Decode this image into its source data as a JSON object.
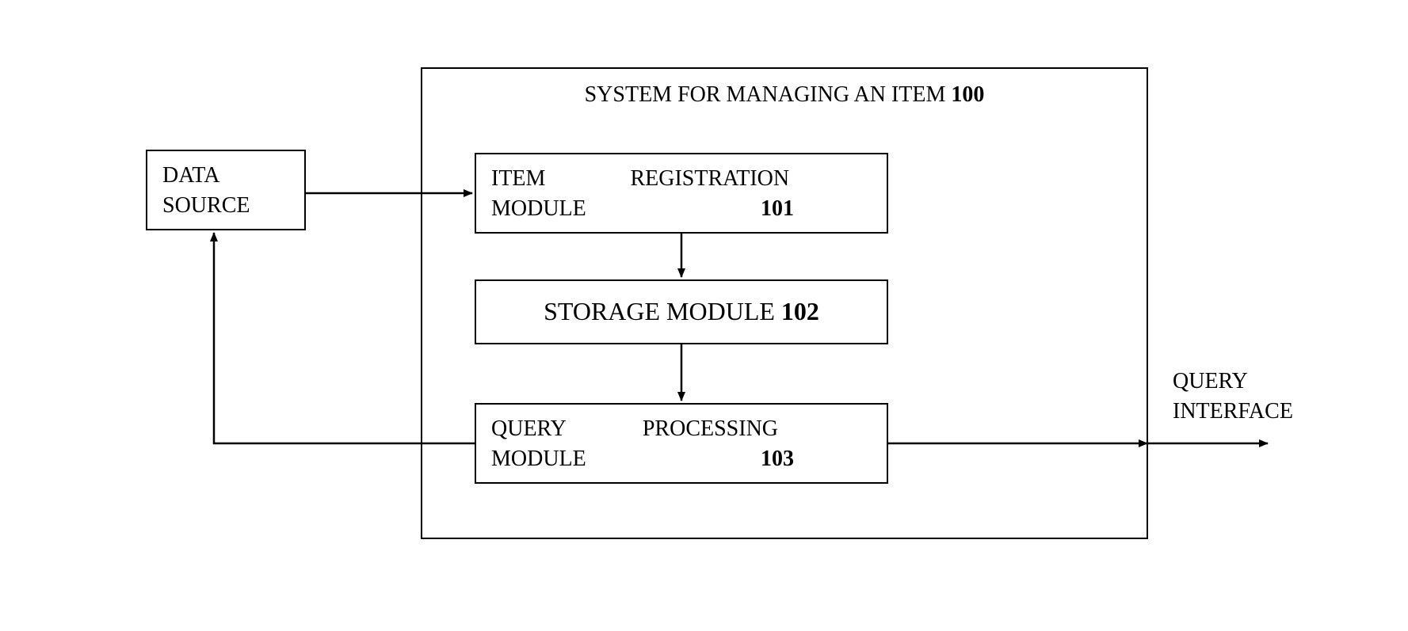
{
  "diagram": {
    "title_prefix": "SYSTEM FOR MANAGING AN ITEM ",
    "title_num": "100",
    "data_source_l1": "DATA",
    "data_source_l2": "SOURCE",
    "item_reg_l1a": "ITEM",
    "item_reg_l1b": "REGISTRATION",
    "item_reg_l2a": "MODULE",
    "item_reg_num": "101",
    "storage_prefix": "STORAGE MODULE ",
    "storage_num": "102",
    "query_proc_l1a": "QUERY",
    "query_proc_l1b": "PROCESSING",
    "query_proc_l2a": "MODULE",
    "query_proc_num": "103",
    "query_if_l1": "QUERY",
    "query_if_l2": "INTERFACE"
  }
}
